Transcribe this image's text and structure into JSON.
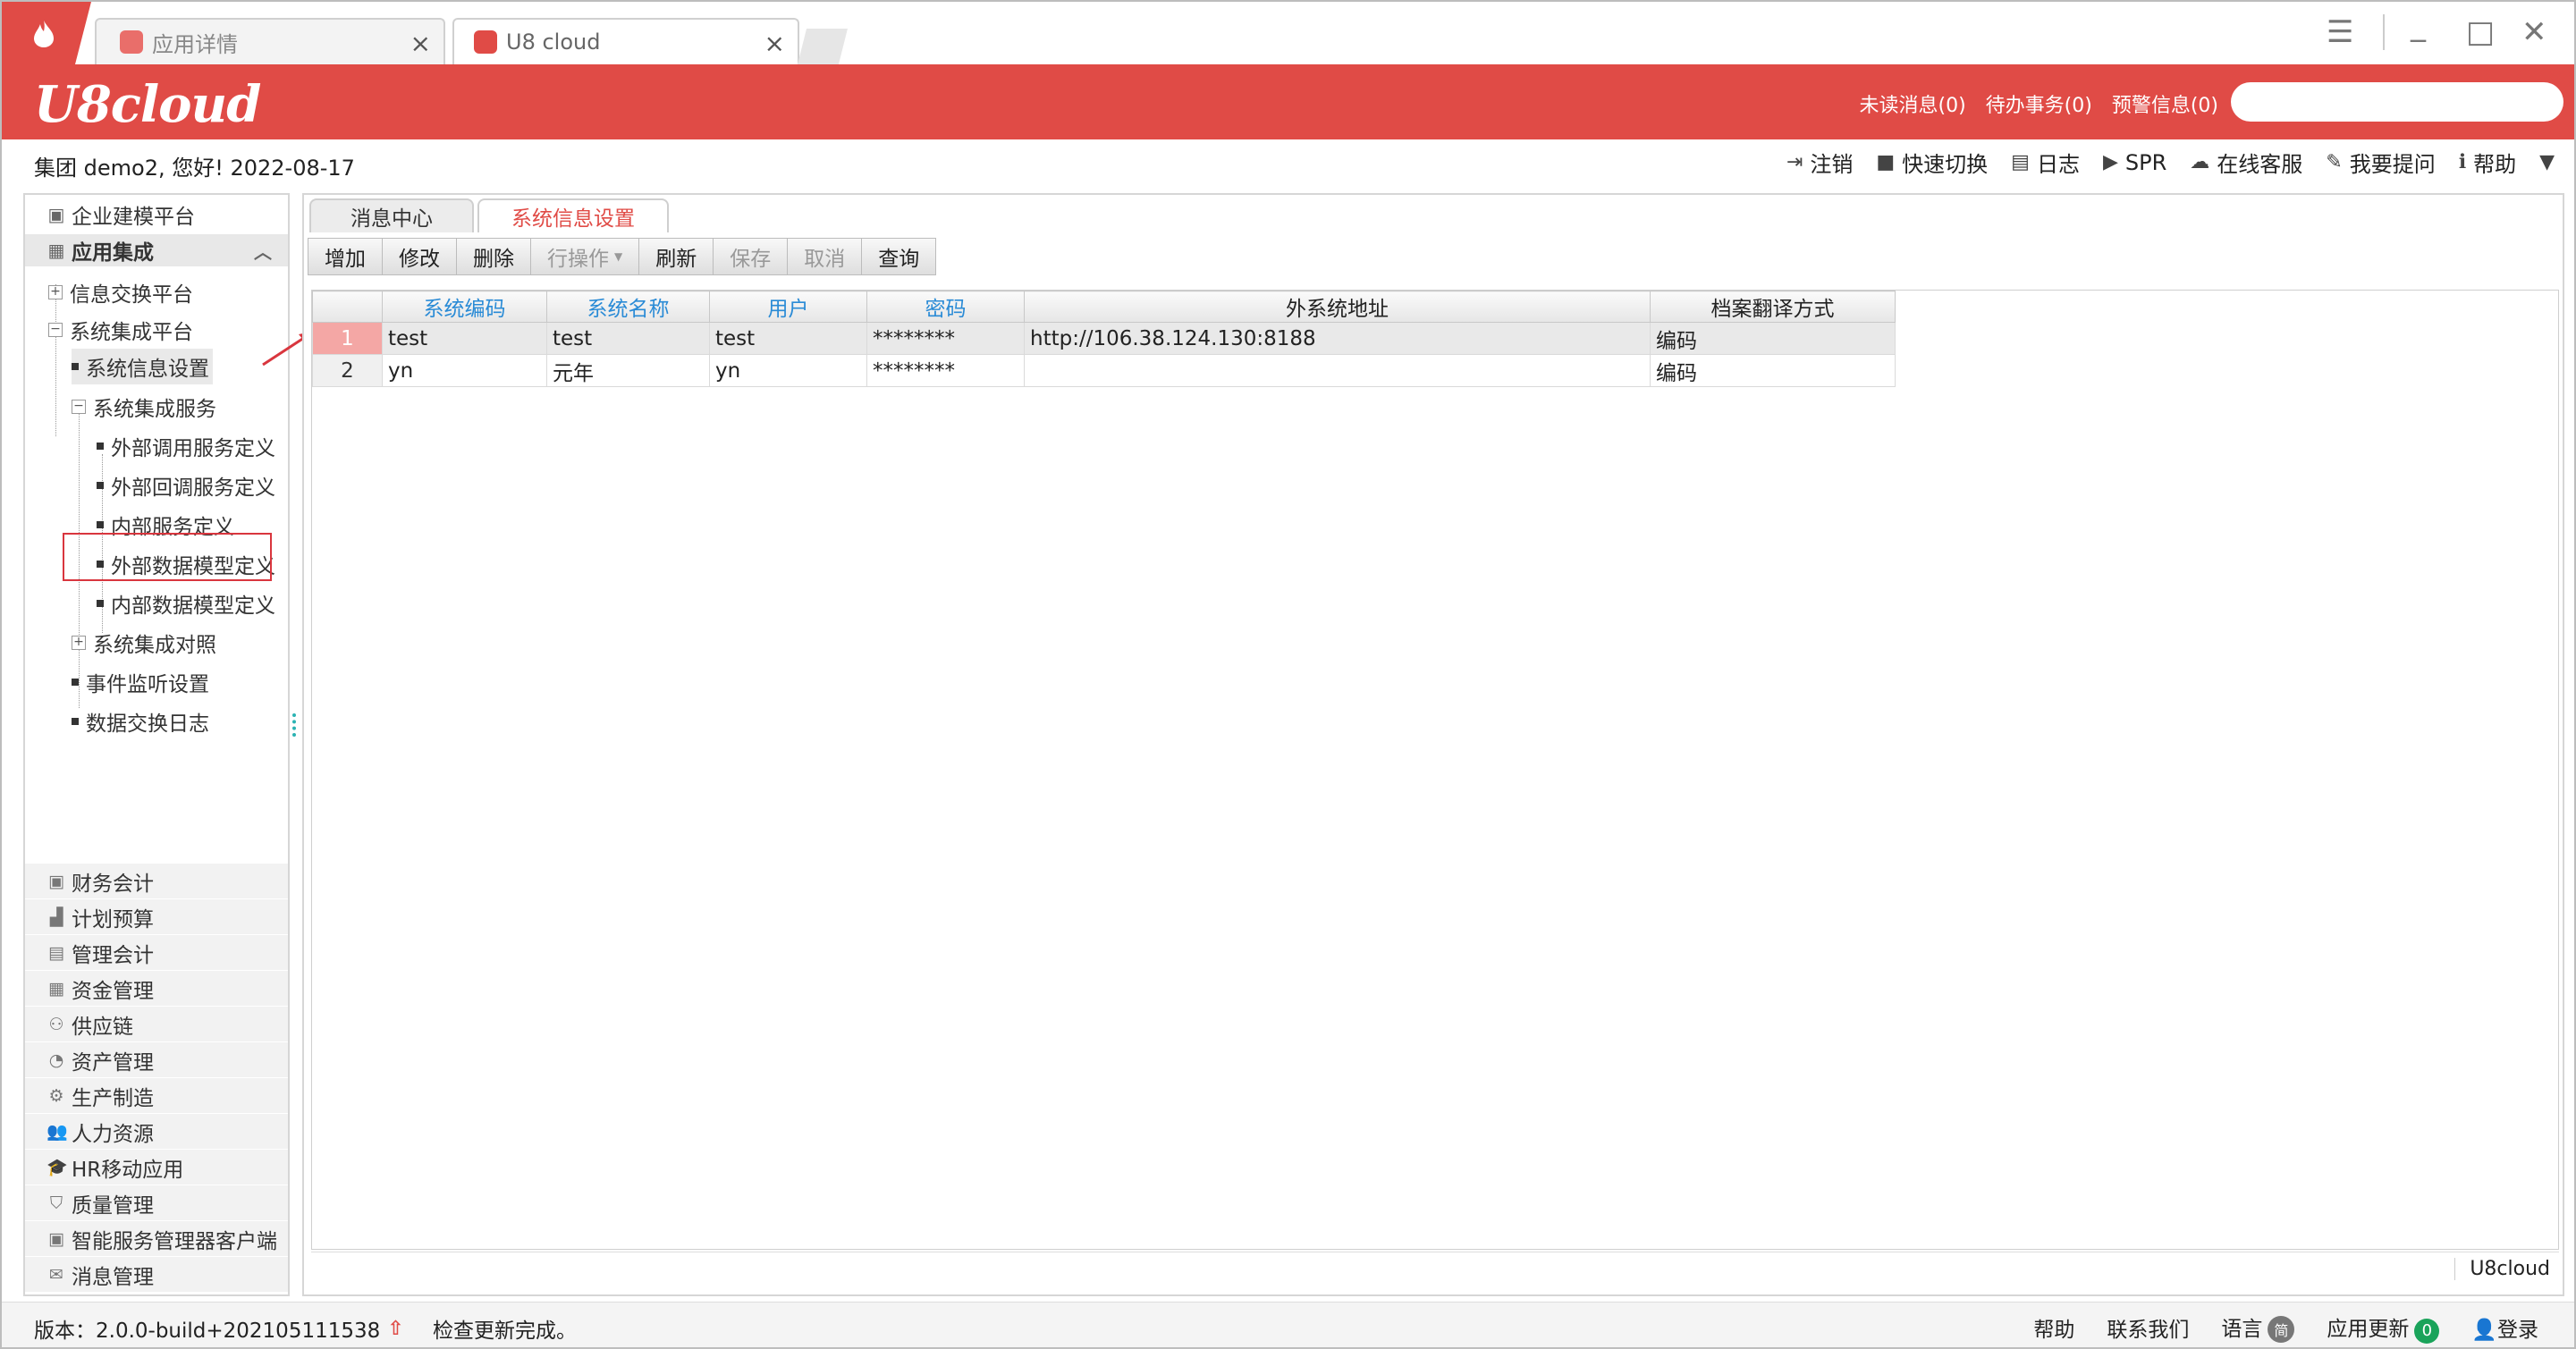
{
  "browser_tabs": [
    {
      "label": "应用详情",
      "active": false
    },
    {
      "label": "U8 cloud",
      "active": true
    }
  ],
  "brand": {
    "name": "U8cloud"
  },
  "header_links": [
    "未读消息(0)",
    "待办事务(0)",
    "预警信息(0)"
  ],
  "search": {
    "placeholder": "",
    "value": ""
  },
  "greeting": "集团 demo2, 您好! 2022-08-17",
  "top_toolbar": [
    {
      "label": "注销",
      "icon": "logout-icon"
    },
    {
      "label": "快速切换",
      "icon": "switch-icon"
    },
    {
      "label": "日志",
      "icon": "log-icon"
    },
    {
      "label": "SPR",
      "icon": "play-icon"
    },
    {
      "label": "在线客服",
      "icon": "cloud-icon"
    },
    {
      "label": "我要提问",
      "icon": "question-icon"
    },
    {
      "label": "帮助",
      "icon": "help-icon"
    }
  ],
  "sidebar": {
    "platform": "企业建模平台",
    "group": "应用集成",
    "tree": {
      "info_exchange": "信息交换平台",
      "sys_integration": "系统集成平台",
      "sys_info_settings": "系统信息设置",
      "sys_services": "系统集成服务",
      "ext_call": "外部调用服务定义",
      "ext_callback": "外部回调服务定义",
      "internal_service": "内部服务定义",
      "ext_data_model": "外部数据模型定义",
      "int_data_model": "内部数据模型定义",
      "sys_mapping": "系统集成对照",
      "event_listener": "事件监听设置",
      "data_log": "数据交换日志"
    },
    "modules": [
      "财务会计",
      "计划预算",
      "管理会计",
      "资金管理",
      "供应链",
      "资产管理",
      "生产制造",
      "人力资源",
      "HR移动应用",
      "质量管理",
      "智能服务管理器客户端",
      "消息管理"
    ]
  },
  "content_tabs": [
    {
      "label": "消息中心",
      "active": false
    },
    {
      "label": "系统信息设置",
      "active": true
    }
  ],
  "buttons": [
    {
      "label": "增加",
      "enabled": true
    },
    {
      "label": "修改",
      "enabled": true
    },
    {
      "label": "删除",
      "enabled": true
    },
    {
      "label": "行操作",
      "enabled": false
    },
    {
      "label": "刷新",
      "enabled": true
    },
    {
      "label": "保存",
      "enabled": false
    },
    {
      "label": "取消",
      "enabled": false
    },
    {
      "label": "查询",
      "enabled": true
    }
  ],
  "grid": {
    "columns": [
      "系统编码",
      "系统名称",
      "用户",
      "密码",
      "外系统地址",
      "档案翻译方式"
    ],
    "rows": [
      {
        "no": "1",
        "cells": [
          "test",
          "test",
          "test",
          "********",
          "http://106.38.124.130:8188",
          "编码"
        ]
      },
      {
        "no": "2",
        "cells": [
          "yn",
          "元年",
          "yn",
          "********",
          "",
          "编码"
        ]
      }
    ]
  },
  "content_footer": "U8cloud",
  "statusbar": {
    "version": "版本：2.0.0-build+202105111538",
    "message": "检查更新完成。",
    "help": "帮助",
    "contact": "联系我们",
    "language": "语言",
    "language_badge": "简",
    "update": "应用更新",
    "update_count": "0",
    "login": "登录"
  },
  "colors": {
    "brand_red": "#e04b46",
    "link_blue": "#2a8bd6",
    "annotation_red": "#d9363e"
  }
}
